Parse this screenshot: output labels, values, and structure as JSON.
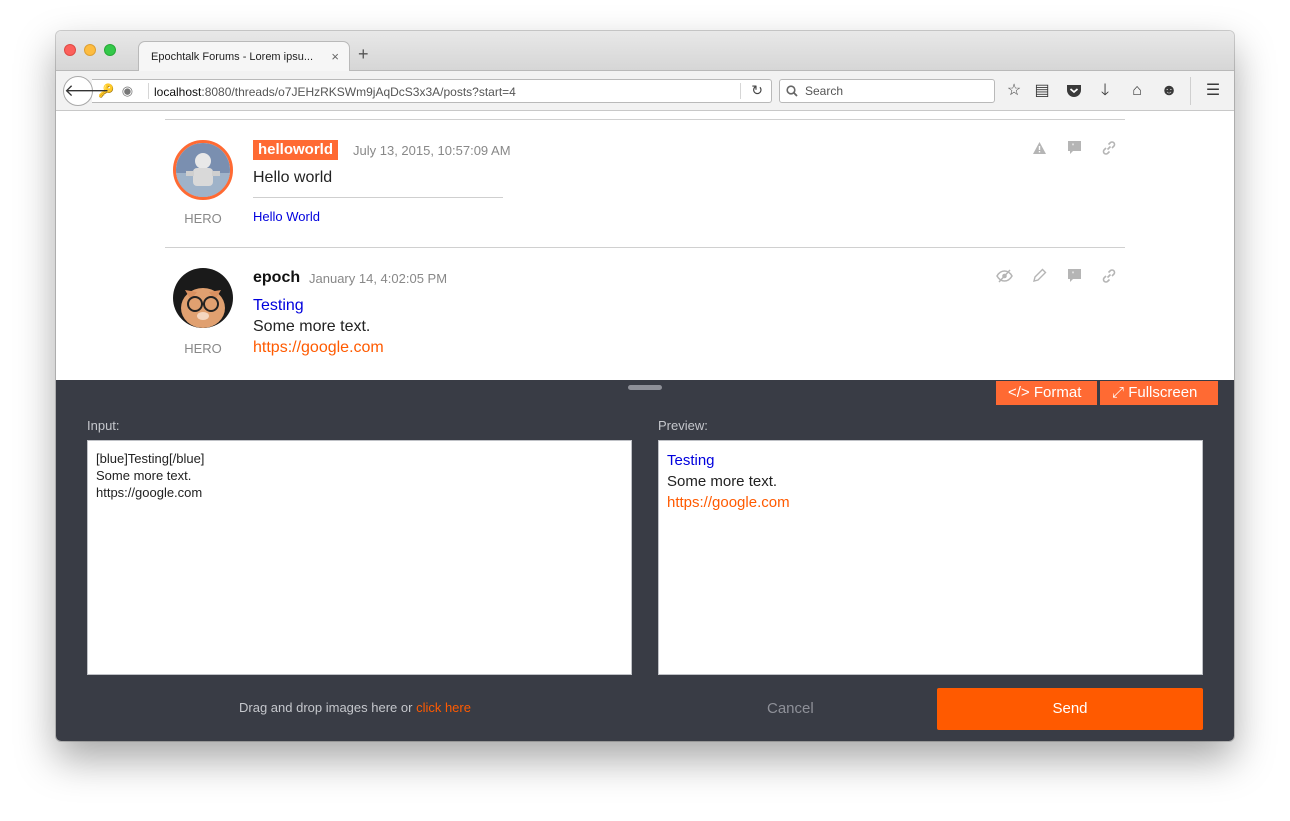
{
  "browser": {
    "tab_title": "Epochtalk Forums - Lorem ipsu...",
    "tab_close": "×",
    "new_tab": "+",
    "url_host": "localhost",
    "url_rest": ":8080/threads/o7JEHzRKSWm9jAqDcS3x3A/posts?start=4",
    "search_placeholder": "Search"
  },
  "posts": [
    {
      "username": "helloworld",
      "role": "HERO",
      "timestamp": "July 13, 2015, 10:57:09 AM",
      "body": "Hello world",
      "signature": "Hello World"
    },
    {
      "username": "epoch",
      "role": "HERO",
      "timestamp": "January 14, 4:02:05 PM",
      "body_blue": "Testing",
      "body_line2": "Some more text.",
      "body_link": "https://google.com"
    }
  ],
  "editor": {
    "format_label": "Format",
    "fullscreen_label": "Fullscreen",
    "input_label": "Input:",
    "preview_label": "Preview:",
    "input_value": "[blue]Testing[/blue]\nSome more text.\nhttps://google.com",
    "preview_blue": "Testing",
    "preview_line2": "Some more text.",
    "preview_link": "https://google.com",
    "dropzone_text": "Drag and drop images here or",
    "dropzone_link": "click here",
    "cancel_label": "Cancel",
    "send_label": "Send"
  },
  "colors": {
    "accent": "#ff6a33",
    "send": "#ff5a00",
    "editor_bg": "#393c45",
    "blue_text": "#0000dd"
  }
}
